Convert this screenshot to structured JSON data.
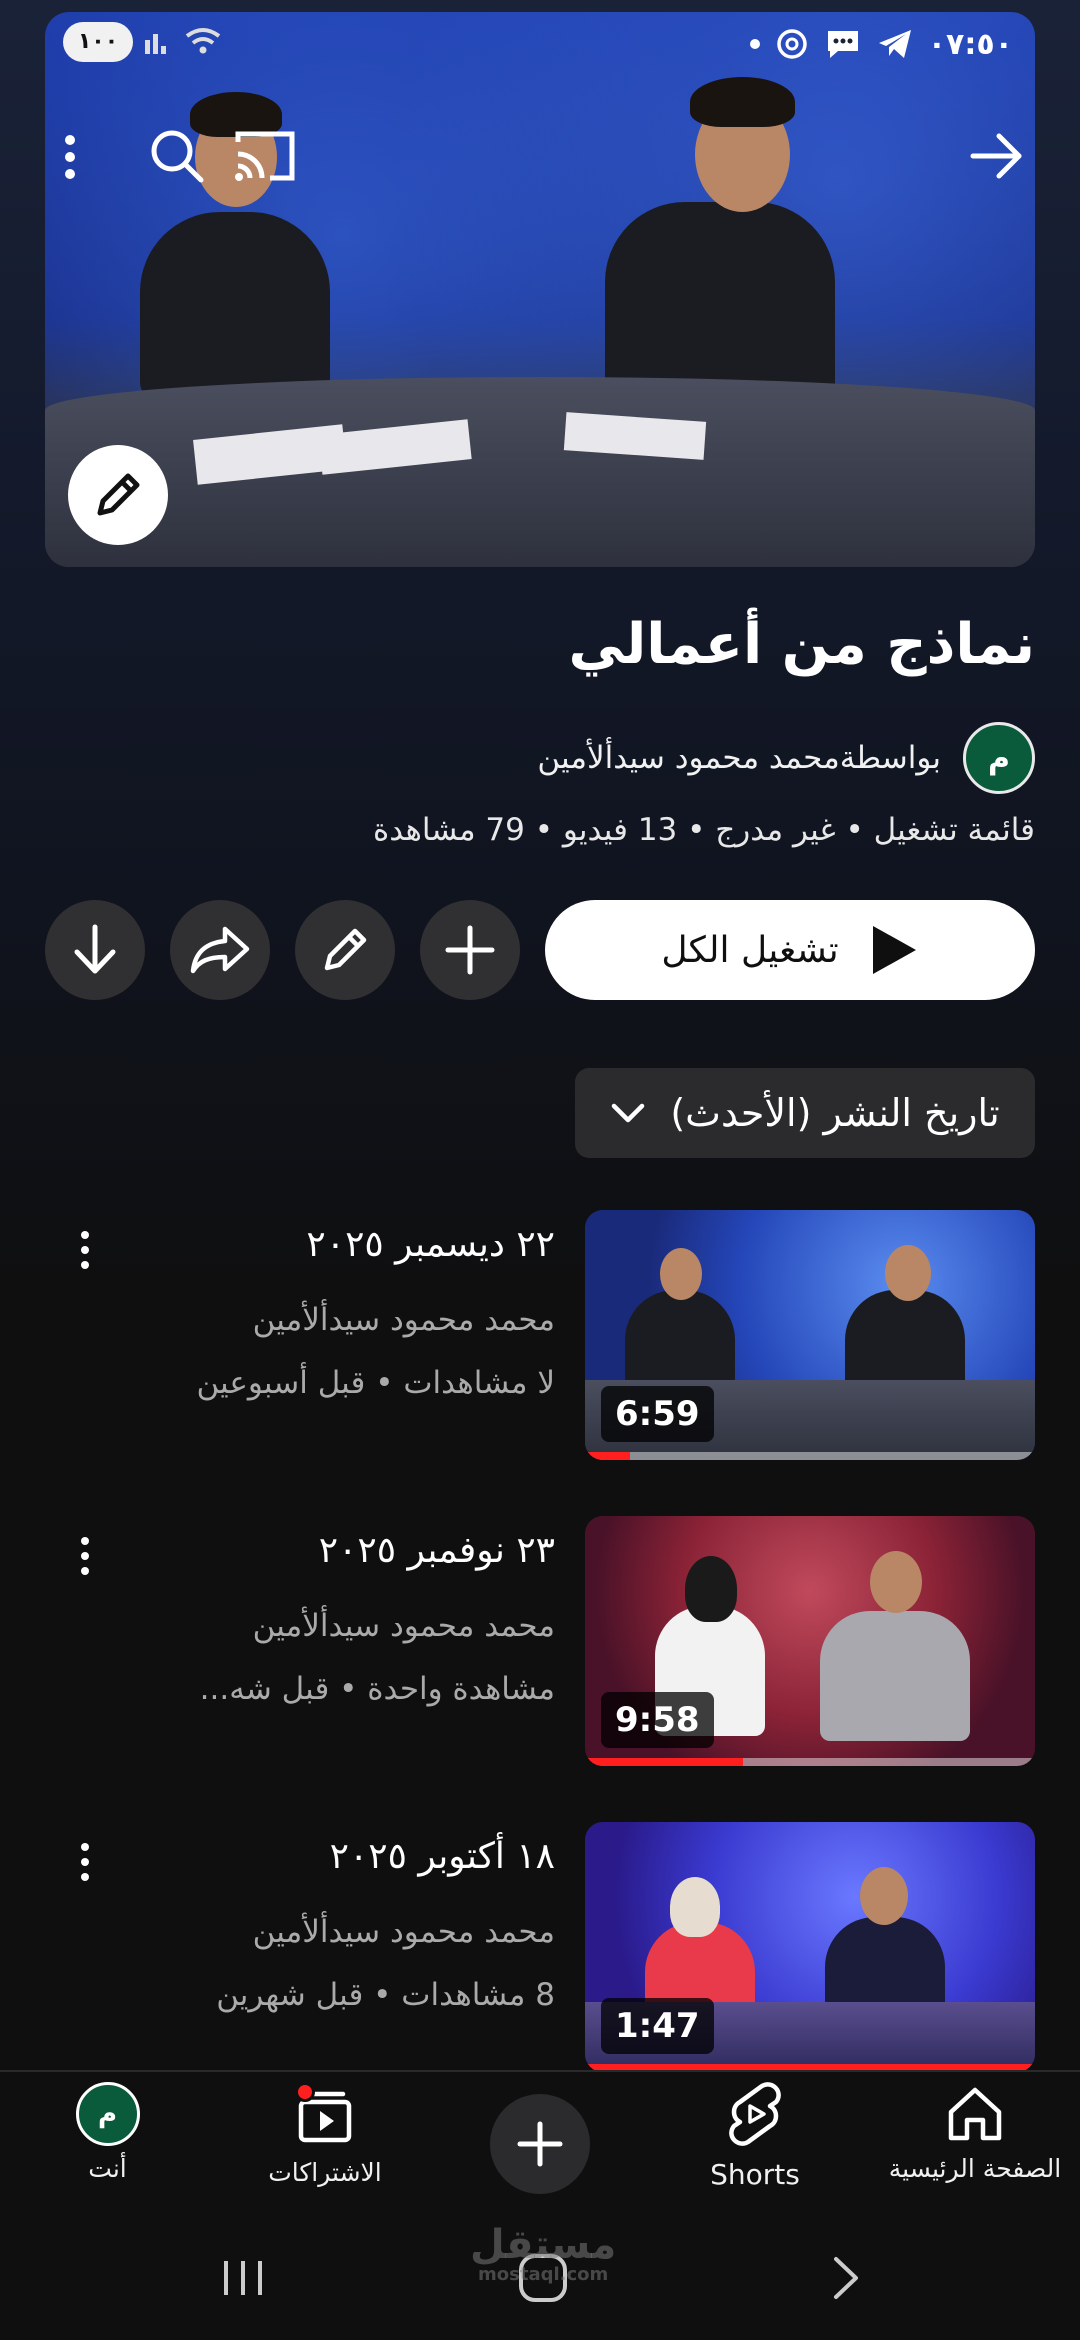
{
  "status_bar": {
    "time": "٠٧:٥٠",
    "battery": "١٠٠"
  },
  "playlist": {
    "title": "نماذج من أعمالي",
    "owner_initial": "م",
    "owner": "بواسطةمحمد محمود سيدألأمين",
    "meta": "قائمة تشغيل • غير مدرج • 13 فيديو • 79 مشاهدة"
  },
  "actions": {
    "play_all_label": "تشغيل الكل"
  },
  "sort": {
    "selected": "تاريخ النشر (الأحدث)"
  },
  "videos": [
    {
      "title": "٢٢ ديسمبر ٢٠٢٥",
      "channel": "محمد محمود سيدألأمين",
      "stats": "لا مشاهدات • قبل أسبوعين",
      "duration": "6:59",
      "progress": 0.1
    },
    {
      "title": "٢٣ نوفمبر ٢٠٢٥",
      "channel": "محمد محمود سيدألأمين",
      "stats": "مشاهدة واحدة • قبل شه...",
      "duration": "9:58",
      "progress": 0.35
    },
    {
      "title": "١٨ أكتوبر ٢٠٢٥",
      "channel": "محمد محمود سيدألأمين",
      "stats": "8 مشاهدات • قبل شهرين",
      "duration": "1:47",
      "progress": 1.0
    }
  ],
  "bottom_nav": {
    "home": "الصفحة الرئيسية",
    "shorts": "Shorts",
    "subscriptions": "الاشتراكات",
    "you": "أنت",
    "you_initial": "م"
  },
  "watermark": {
    "line1": "مستقل",
    "line2": "mostaql.com"
  },
  "colors": {
    "accent_red": "#ff1f1f",
    "avatar_green": "#0a5b3b",
    "background": "#0f0f0f"
  }
}
